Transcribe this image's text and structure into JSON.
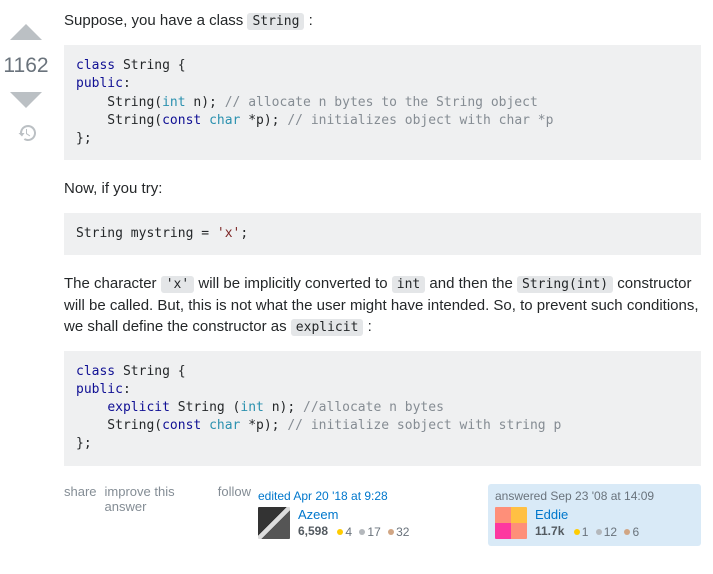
{
  "vote": {
    "count": "1162"
  },
  "para1": {
    "pre": "Suppose, you have a class ",
    "code": "String",
    "post": " :"
  },
  "code1": {
    "l1a": "class",
    "l1b": " String {",
    "l2": "public",
    "l3a": "    String(",
    "l3b": "int",
    "l3c": " n); ",
    "l3d": "// allocate n bytes to the String object",
    "l4a": "    String(",
    "l4b": "const",
    "l4c": " ",
    "l4d": "char",
    "l4e": " *p); ",
    "l4f": "// initializes object with char *p",
    "l5": "};"
  },
  "para2": "Now, if you try:",
  "code2": {
    "a": "String mystring = ",
    "b": "'x'",
    "c": ";"
  },
  "para3": {
    "t1": "The character ",
    "c1": "'x'",
    "t2": " will be implicitly converted to ",
    "c2": "int",
    "t3": " and then the ",
    "c3": "String(int)",
    "t4": " constructor will be called. But, this is not what the user might have intended. So, to prevent such conditions, we shall define the constructor as ",
    "c4": "explicit",
    "t5": " :"
  },
  "code3": {
    "l1a": "class",
    "l1b": " String {",
    "l2": "public",
    "l3a": "    ",
    "l3b": "explicit",
    "l3c": " String (",
    "l3d": "int",
    "l3e": " n); ",
    "l3f": "//allocate n bytes",
    "l4a": "    String(",
    "l4b": "const",
    "l4c": " ",
    "l4d": "char",
    "l4e": " *p); ",
    "l4f": "// initialize sobject with string p",
    "l5": "};"
  },
  "actions": {
    "share": "share",
    "improve": "improve this answer",
    "follow": "follow"
  },
  "editor": {
    "action": "edited",
    "timestamp": "Apr 20 '18 at 9:28",
    "name": "Azeem",
    "rep": "6,598",
    "gold": "4",
    "silver": "17",
    "bronze": "32"
  },
  "author": {
    "action": "answered",
    "timestamp": "Sep 23 '08 at 14:09",
    "name": "Eddie",
    "rep": "11.7k",
    "gold": "1",
    "silver": "12",
    "bronze": "6"
  }
}
